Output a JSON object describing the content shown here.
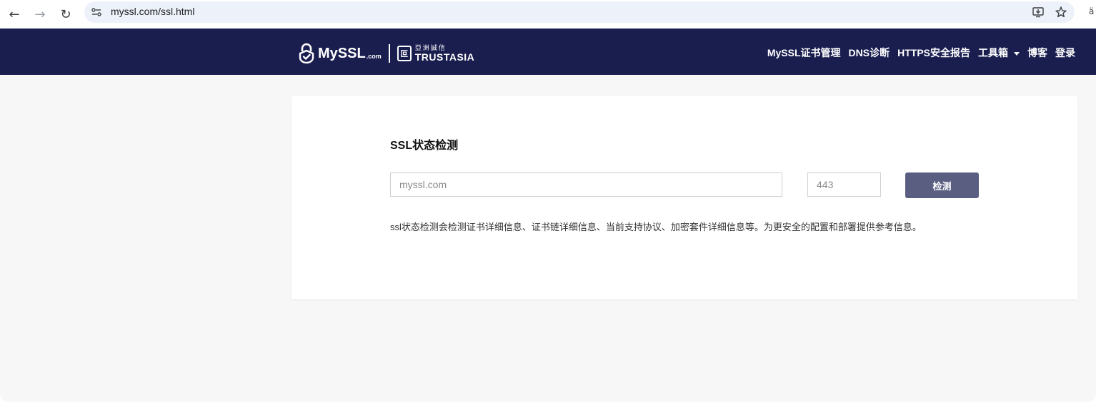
{
  "browser": {
    "back_icon": "←",
    "forward_icon": "→",
    "reload_icon": "↻",
    "url": "myssl.com/ssl.html",
    "install_icon": "⤓",
    "star_icon": "☆",
    "edge_glyph": "ä"
  },
  "header": {
    "logo": {
      "my": "My",
      "ssl": "SSL",
      "com": ".com",
      "ta_mark": "叵",
      "ta_cn": "亞洲誠信",
      "ta_en": "TRUSTASIA"
    },
    "nav": [
      {
        "label": "MySSL证书管理"
      },
      {
        "label": "DNS诊断"
      },
      {
        "label": "HTTPS安全报告"
      },
      {
        "label": "工具箱"
      },
      {
        "label": "博客"
      },
      {
        "label": "登录"
      }
    ],
    "colors": {
      "background": "#1a1e4f",
      "text": "#ffffff"
    }
  },
  "card": {
    "title": "SSL状态检测",
    "domain_placeholder": "myssl.com",
    "port_placeholder": "443",
    "button_label": "检测",
    "description": "ssl状态检测会检测证书详细信息、证书链详细信息、当前支持协议、加密套件详细信息等。为更安全的配置和部署提供参考信息。",
    "colors": {
      "button": "#5a5f82",
      "page_background": "#f7f7f7"
    }
  }
}
